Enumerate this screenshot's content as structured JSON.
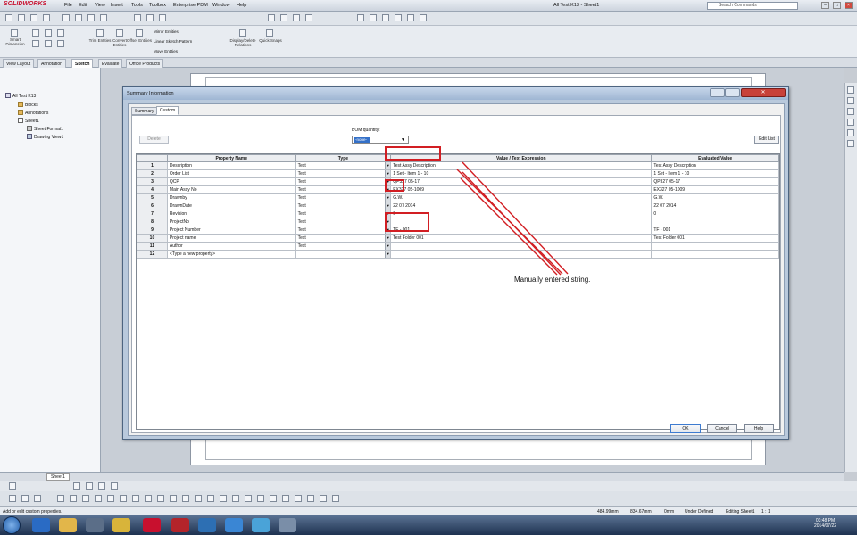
{
  "app": {
    "brand": "SOLIDWORKS",
    "menu": [
      "File",
      "Edit",
      "View",
      "Insert",
      "Tools",
      "Toolbox",
      "Enterprise PDM",
      "Window",
      "Help"
    ],
    "document_title": "All Test K13 - Sheet1",
    "search_placeholder": "Search Commands"
  },
  "command_manager": {
    "buttons": [
      "Smart Dimension",
      "Trim Entities",
      "Convert Entities",
      "Offset Entities",
      "Mirror Entities",
      "Linear Sketch Pattern",
      "Move Entities",
      "Display/Delete Relations",
      "Quick Snaps"
    ],
    "tabs": [
      "View Layout",
      "Annotation",
      "Sketch",
      "Evaluate",
      "Office Products"
    ],
    "active_tab": "Sketch"
  },
  "tree": {
    "root": "All Test K13",
    "items": [
      "Blocks",
      "Annotations",
      "Sheet1",
      "Sheet Format1",
      "Drawing View1"
    ]
  },
  "dialog": {
    "title": "Summary Information",
    "tabs": [
      "Summary",
      "Custom"
    ],
    "active_tab": "Custom",
    "delete_label": "Delete",
    "bom_quantity_label": "BOM quantity:",
    "bom_quantity_value": "-none-",
    "edit_list_label": "Edit List",
    "columns": [
      "Property Name",
      "Type",
      "Value / Text Expression",
      "Evaluated Value"
    ],
    "rows": [
      {
        "num": "1",
        "name": "Description",
        "type": "Text",
        "value": "Test Assy Description",
        "evaluated": "Test Assy Description"
      },
      {
        "num": "2",
        "name": "Order List",
        "type": "Text",
        "value": "1 Set - Item 1 - 10",
        "evaluated": "1 Set - Item 1 - 10"
      },
      {
        "num": "3",
        "name": "QCP",
        "type": "Text",
        "value": "QP327 05-17",
        "evaluated": "QP327 05-17"
      },
      {
        "num": "4",
        "name": "Main Assy No",
        "type": "Text",
        "value": "EX327 05-1009",
        "evaluated": "EX327 05-1009"
      },
      {
        "num": "5",
        "name": "Drawnby",
        "type": "Text",
        "value": "G.W.",
        "evaluated": "G.W."
      },
      {
        "num": "6",
        "name": "DrawnDate",
        "type": "Text",
        "value": "22 07 2014",
        "evaluated": "22 07 2014"
      },
      {
        "num": "7",
        "name": "Revision",
        "type": "Text",
        "value": "0",
        "evaluated": "0"
      },
      {
        "num": "8",
        "name": "ProjectNo",
        "type": "Text",
        "value": "",
        "evaluated": ""
      },
      {
        "num": "9",
        "name": "Project Number",
        "type": "Text",
        "value": "TF - 001",
        "evaluated": "TF - 001"
      },
      {
        "num": "10",
        "name": "Project name",
        "type": "Text",
        "value": "Test Folder 001",
        "evaluated": "Test Folder 001"
      },
      {
        "num": "11",
        "name": "Author",
        "type": "Text",
        "value": "",
        "evaluated": ""
      },
      {
        "num": "12",
        "name": "<Type a new property>",
        "type": "",
        "value": "",
        "evaluated": ""
      }
    ],
    "ok_label": "OK",
    "cancel_label": "Cancel",
    "help_label": "Help"
  },
  "annotation": {
    "text": "Manually entered string.",
    "color": "#d21e23"
  },
  "sheet_tab": "Sheet1",
  "status": {
    "hint": "Add or edit custom properties.",
    "x": "484.99mm",
    "y": "834.67mm",
    "z": "0mm",
    "state": "Under Defined",
    "editing": "Editing Sheet1",
    "scale": "1 : 1"
  },
  "clock": {
    "time": "03:48 PM",
    "date": "2014/07/22"
  }
}
